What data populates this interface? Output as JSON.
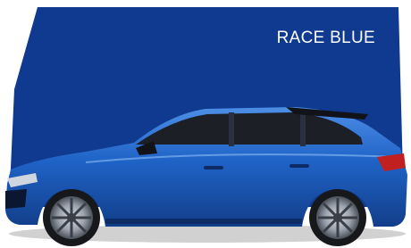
{
  "color_name": "RACE BLUE",
  "colors": {
    "swatch_blue": "#0f3a8f",
    "body_blue": "#1f63c7",
    "body_highlight": "#4d8fe6",
    "body_shadow": "#123e8a",
    "window_dark": "#1c1f26",
    "tyre": "#16181c",
    "rim": "#9aa2ad",
    "tail_light": "#c02020"
  }
}
